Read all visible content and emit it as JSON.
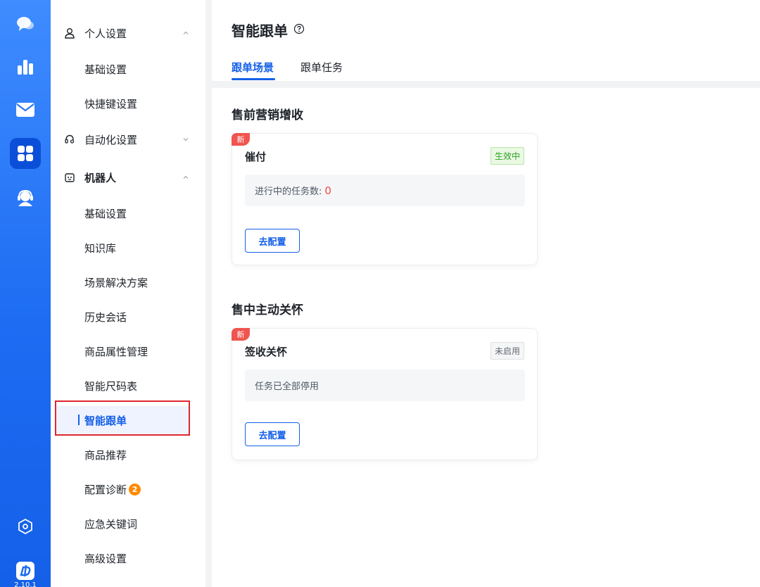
{
  "rail": {
    "version": "2.10.1",
    "icons": [
      "chat-icon",
      "chart-icon",
      "mail-icon",
      "apps-icon",
      "support-icon",
      "settings-hex-icon",
      "brand-logo-icon"
    ]
  },
  "nav": {
    "personal_settings": "个人设置",
    "personal_basic": "基础设置",
    "shortcut_settings": "快捷键设置",
    "automation_settings": "自动化设置",
    "robot": "机器人",
    "robot_items": {
      "basic": "基础设置",
      "knowledge": "知识库",
      "scene_solution": "场景解决方案",
      "history": "历史会话",
      "product_attr": "商品属性管理",
      "size_chart": "智能尺码表",
      "smart_followup": "智能跟单",
      "recommend": "商品推荐",
      "diagnosis": "配置诊断",
      "diagnosis_badge": "2",
      "emergency_keywords": "应急关键词",
      "advanced": "高级设置"
    }
  },
  "header": {
    "title": "智能跟单",
    "tabs": [
      "跟单场景",
      "跟单任务"
    ]
  },
  "sections": [
    {
      "title": "售前营销增收",
      "card": {
        "tag": "新",
        "name": "催付",
        "status": "生效中",
        "info_label": "进行中的任务数:",
        "info_count": "0",
        "button": "去配置"
      }
    },
    {
      "title": "售中主动关怀",
      "card": {
        "tag": "新",
        "name": "签收关怀",
        "status": "未启用",
        "info_label": "任务已全部停用",
        "button": "去配置"
      }
    }
  ],
  "colors": {
    "accent": "#1560e8",
    "rail_top": "#3f8cff",
    "new_tag": "#f0554f",
    "active_status": "#2ea121",
    "badge": "#ff8a00",
    "highlight_border": "#e0262d"
  }
}
